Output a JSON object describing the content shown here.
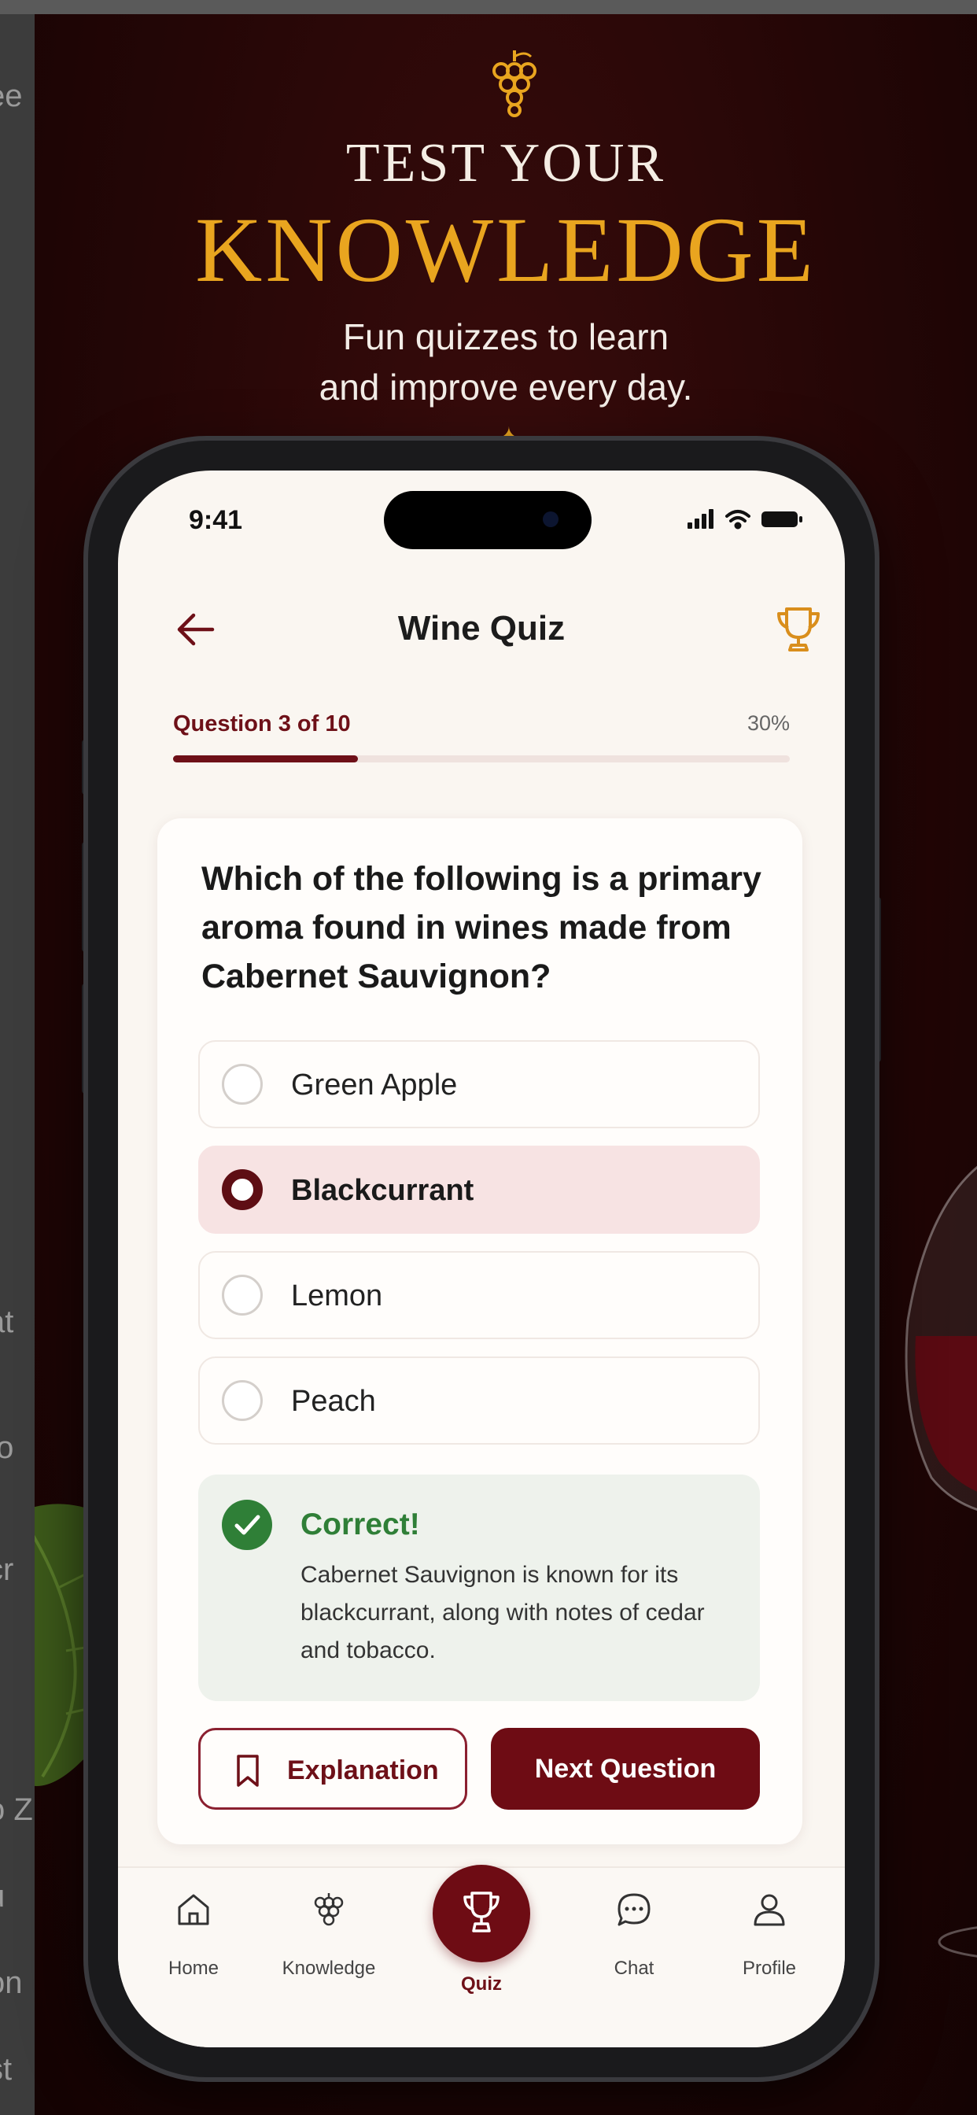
{
  "background_cropped_text": [
    "ee",
    "at",
    "to",
    "cr",
    "o Z",
    "u",
    "on",
    "st"
  ],
  "poster": {
    "headline_line1": "TEST YOUR",
    "headline_line2": "KNOWLEDGE",
    "subline_1": "Fun quizzes to learn",
    "subline_2": "and improve every day.",
    "accent_color": "#e9a51f"
  },
  "status_bar": {
    "time": "9:41"
  },
  "nav": {
    "title": "Wine Quiz"
  },
  "progress": {
    "label": "Question 3 of 10",
    "percent_label": "30%",
    "value": 0.3
  },
  "quiz": {
    "question": "Which of the following is a primary aroma found in wines made from Cabernet Sauvignon?",
    "options": [
      {
        "label": "Green Apple",
        "selected": false
      },
      {
        "label": "Blackcurrant",
        "selected": true
      },
      {
        "label": "Lemon",
        "selected": false
      },
      {
        "label": "Peach",
        "selected": false
      }
    ],
    "feedback": {
      "title": "Correct!",
      "body": "Cabernet Sauvignon is known for its blackcurrant, along with notes of cedar and tobacco.",
      "color": "#2f7f37"
    },
    "explanation_label": "Explanation",
    "next_label": "Next Question"
  },
  "tabbar": {
    "items": [
      {
        "label": "Home",
        "icon": "home-icon"
      },
      {
        "label": "Knowledge",
        "icon": "grapes-icon"
      },
      {
        "label": "Quiz",
        "icon": "trophy-icon",
        "active": true
      },
      {
        "label": "Chat",
        "icon": "chat-icon"
      },
      {
        "label": "Profile",
        "icon": "profile-icon"
      }
    ]
  },
  "colors": {
    "brand": "#6e0c14",
    "background": "#240606",
    "screen": "#faf6f1"
  }
}
